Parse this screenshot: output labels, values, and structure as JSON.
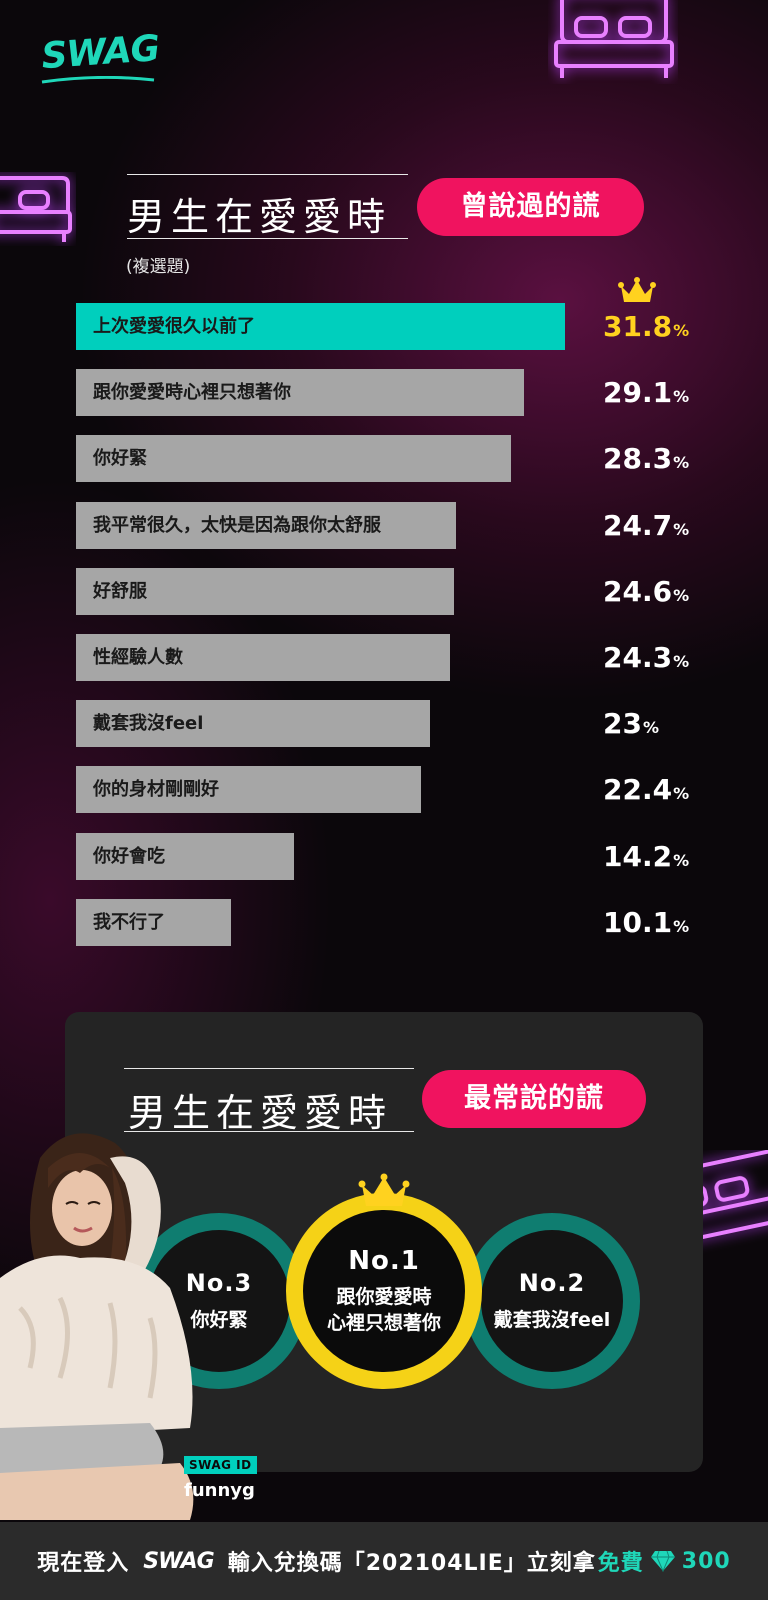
{
  "brand": {
    "logo_text": "SWAG",
    "accent": "#1fd7b9",
    "pink": "#f0135f",
    "gold": "#ffd21f"
  },
  "section1": {
    "title": "男生在愛愛時",
    "pill": "曾說過的謊",
    "note": "(複選題)"
  },
  "chart_data": {
    "type": "bar",
    "orientation": "horizontal",
    "categories": [
      "上次愛愛很久以前了",
      "跟你愛愛時心裡只想著你",
      "你好緊",
      "我平常很久，太快是因為跟你太舒服",
      "好舒服",
      "性經驗人數",
      "戴套我沒feel",
      "你的身材剛剛好",
      "你好會吃",
      "我不行了"
    ],
    "values": [
      31.8,
      29.1,
      28.3,
      24.7,
      24.6,
      24.3,
      23,
      22.4,
      14.2,
      10.1
    ],
    "value_labels": [
      "31.8",
      "29.1",
      "28.3",
      "24.7",
      "24.6",
      "24.3",
      "23",
      "22.4",
      "14.2",
      "10.1"
    ],
    "unit": "%",
    "xlim": [
      0,
      32.5
    ],
    "highlight_index": 0,
    "colors": {
      "highlight": "#00cfbd",
      "default": "#a6a6a6"
    }
  },
  "section2": {
    "title": "男生在愛愛時",
    "pill": "最常說的謊",
    "ranks": [
      {
        "rank": "No.3",
        "text": "你好緊"
      },
      {
        "rank": "No.1",
        "text_line1": "跟你愛愛時",
        "text_line2": "心裡只想著你"
      },
      {
        "rank": "No.2",
        "text": "戴套我沒feel"
      }
    ]
  },
  "swag_id": {
    "label": "SWAG ID",
    "name": "funnyg"
  },
  "footer": {
    "part1": "現在登入",
    "logo": "SWAG",
    "part2": "輸入兌換碼「202104LIE」立刻拿",
    "free": "免費",
    "amount": "300"
  }
}
